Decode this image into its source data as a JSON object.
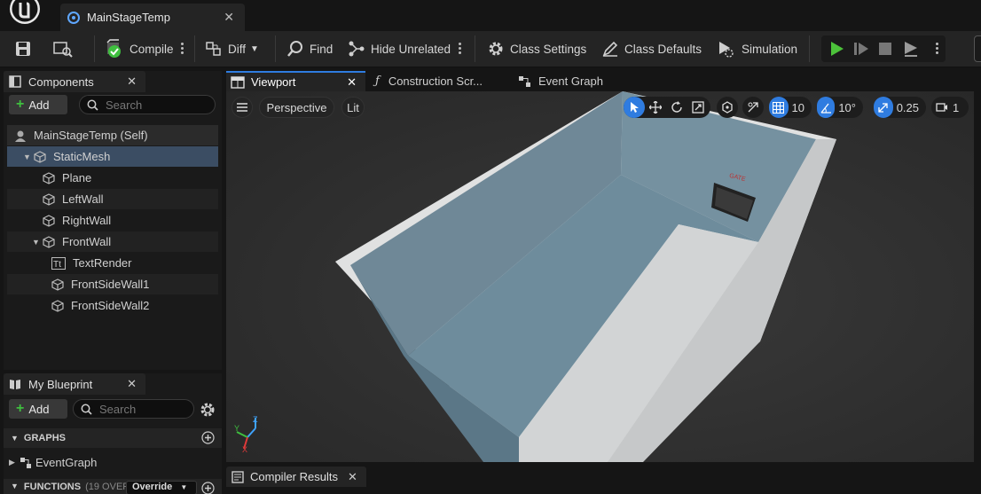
{
  "window": {
    "tab_title": "MainStageTemp"
  },
  "toolbar": {
    "compile": "Compile",
    "diff": "Diff",
    "find": "Find",
    "hide_unrelated": "Hide Unrelated",
    "class_settings": "Class Settings",
    "class_defaults": "Class Defaults",
    "simulation": "Simulation"
  },
  "components": {
    "tab_label": "Components",
    "add_label": "Add",
    "search_placeholder": "Search",
    "items": [
      {
        "label": "MainStageTemp (Self)",
        "icon": "actor-icon"
      },
      {
        "label": "StaticMesh",
        "icon": "cube-icon"
      },
      {
        "label": "Plane",
        "icon": "cube-icon"
      },
      {
        "label": "LeftWall",
        "icon": "cube-icon"
      },
      {
        "label": "RightWall",
        "icon": "cube-icon"
      },
      {
        "label": "FrontWall",
        "icon": "cube-icon"
      },
      {
        "label": "TextRender",
        "icon": "text-render-icon"
      },
      {
        "label": "FrontSideWall1",
        "icon": "cube-icon"
      },
      {
        "label": "FrontSideWall2",
        "icon": "cube-icon"
      }
    ]
  },
  "blueprint": {
    "tab_label": "My Blueprint",
    "add_label": "Add",
    "search_placeholder": "Search",
    "graphs_header": "GRAPHS",
    "event_graph": "EventGraph",
    "functions_header": "FUNCTIONS",
    "functions_count": "(19 OVERR",
    "override_label": "Override"
  },
  "viewport_tabs": {
    "viewport": "Viewport",
    "construction": "Construction Scr...",
    "event_graph": "Event Graph"
  },
  "viewport": {
    "perspective": "Perspective",
    "lit": "Lit",
    "grid_snap": "10",
    "rotation_snap": "10°",
    "scale_snap": "0.25",
    "camera_speed": "1",
    "scene_text": "GATE"
  },
  "bottom": {
    "compiler_results": "Compiler Results"
  },
  "colors": {
    "accent": "#2f7ce0",
    "play_green": "#4cc23a",
    "add_green": "#3fbf3f"
  }
}
